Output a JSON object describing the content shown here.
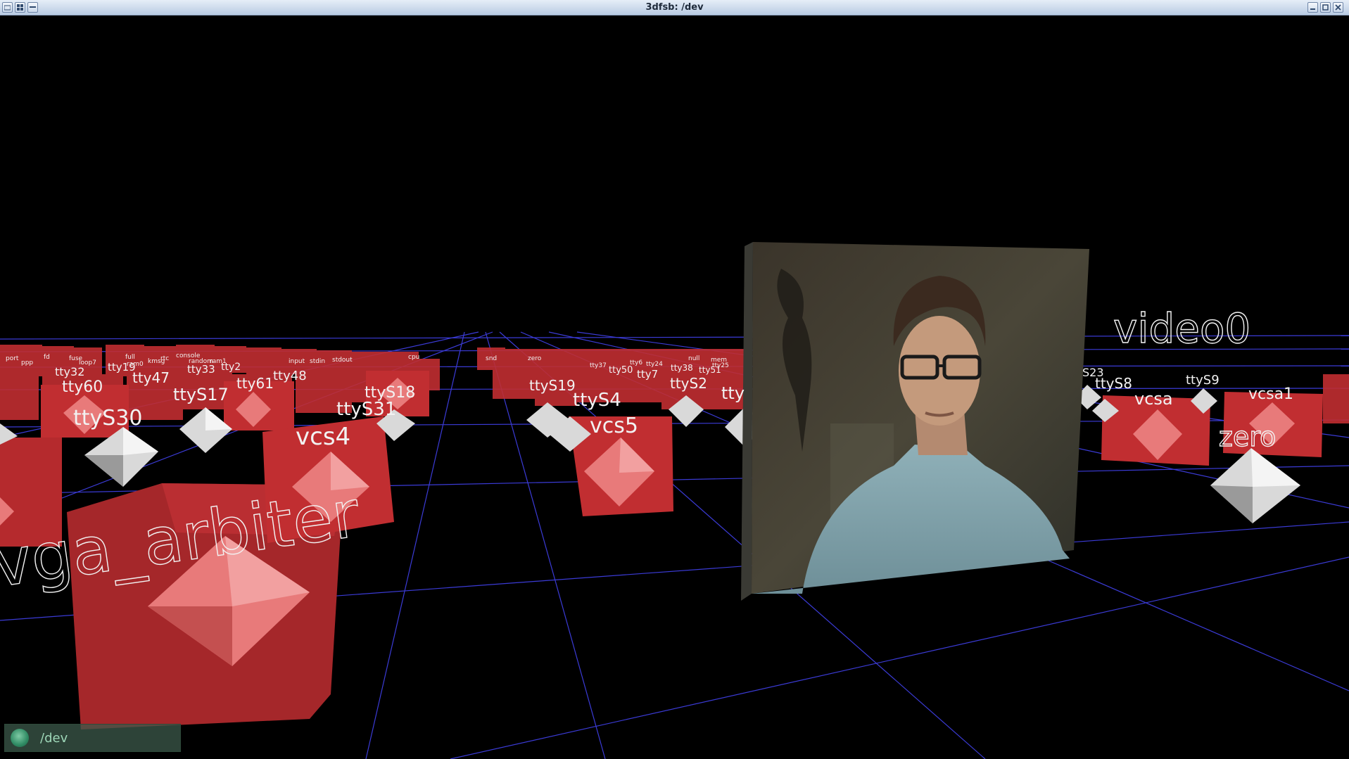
{
  "window": {
    "title": "3dfsb: /dev",
    "controls": [
      "window-menu-icon",
      "pin-icon",
      "shade-icon",
      "minimize-icon",
      "maximize-icon",
      "close-icon"
    ]
  },
  "colors": {
    "cube": "#c12e31",
    "octahedron": "#d9d9d9",
    "grid": "#3b3bd6",
    "label": "#f2f2f2",
    "status_bg": "#3c5a4b",
    "status_text": "#9ed7b8"
  },
  "scene": {
    "video_file_label": "video0",
    "labels_large": {
      "vga_arbiter": "vga_arbiter",
      "ttyS30": "ttyS30",
      "vcs4": "vcs4",
      "vcs5": "vcs5",
      "ttyS31": "ttyS31",
      "ttyS18": "ttyS18",
      "ttyS17": "ttyS17",
      "tty60": "tty60",
      "tty47": "tty47",
      "tty61": "tty61",
      "tty48": "tty48",
      "ttyS4": "ttyS4",
      "ttyS19": "ttyS19",
      "ttyS2": "ttyS2",
      "vcsa": "vcsa",
      "vcsa1": "vcsa1",
      "zero": "zero",
      "ttyS8": "ttyS8",
      "ttyS9": "ttyS9",
      "S23": "S23",
      "tty32": "tty32",
      "tty19": "tty19",
      "tty33": "tty33",
      "tty2": "tty2",
      "tty7": "tty7",
      "tty50": "tty50",
      "tty38": "tty38",
      "tty51": "tty51",
      "tty_partial": "tty"
    },
    "labels_small": [
      "fd",
      "fuse",
      "loop7",
      "stdout",
      "stdin",
      "ram0",
      "ram1",
      "random",
      "port",
      "ppp",
      "rtc",
      "null",
      "mem",
      "tty6",
      "tty24",
      "tty37",
      "tty25",
      "snd",
      "full",
      "kmsg",
      "console",
      "cpu",
      "input",
      "zero"
    ]
  },
  "statusbar": {
    "path": "/dev"
  }
}
